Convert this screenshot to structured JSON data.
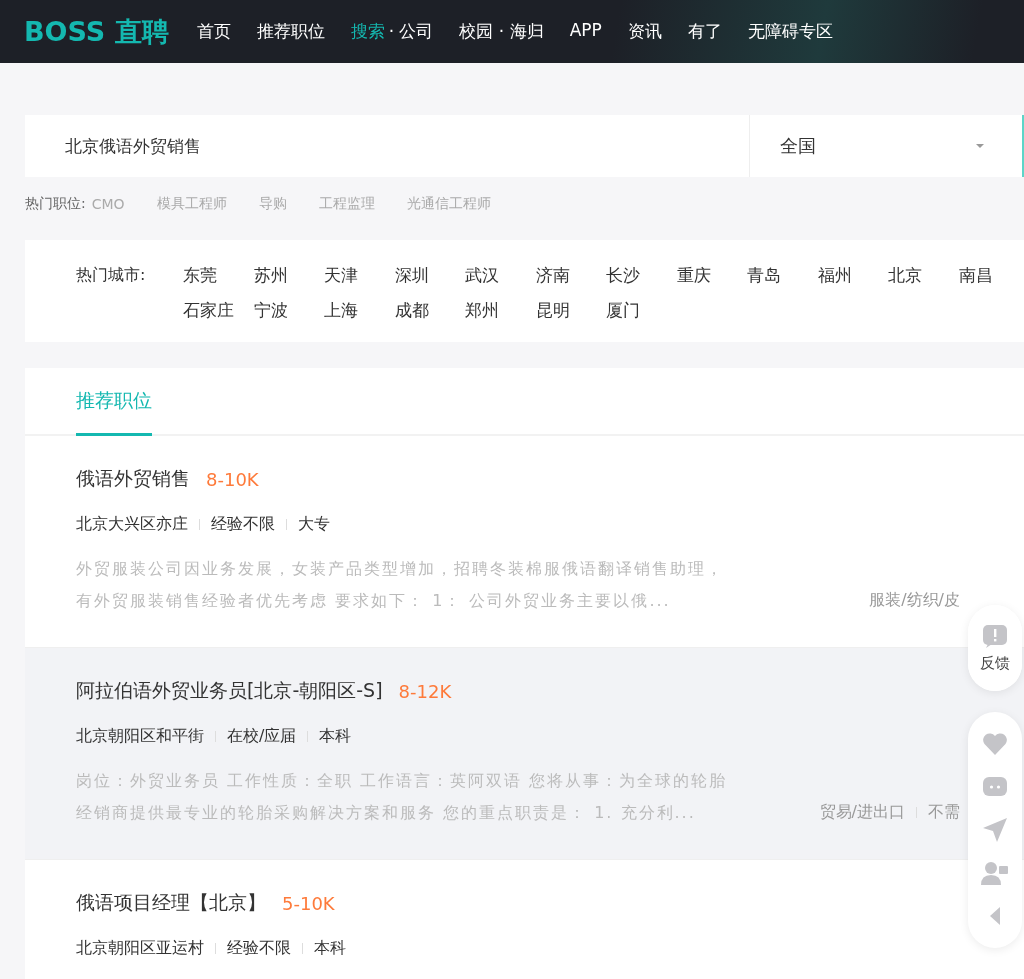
{
  "header": {
    "logo": "BOSS 直聘",
    "nav": [
      {
        "parts": [
          {
            "label": "首页",
            "selected": false
          }
        ]
      },
      {
        "parts": [
          {
            "label": "推荐职位",
            "selected": false
          }
        ]
      },
      {
        "parts": [
          {
            "label": "搜索",
            "selected": true
          },
          {
            "label": "· 公司",
            "selected": false
          }
        ]
      },
      {
        "parts": [
          {
            "label": "校园 · 海归",
            "selected": false
          }
        ]
      },
      {
        "parts": [
          {
            "label": "APP",
            "selected": false
          }
        ]
      },
      {
        "parts": [
          {
            "label": "资讯",
            "selected": false
          }
        ]
      },
      {
        "parts": [
          {
            "label": "有了",
            "selected": false
          }
        ]
      },
      {
        "parts": [
          {
            "label": "无障碍专区",
            "selected": false
          }
        ]
      }
    ]
  },
  "search": {
    "value": "北京俄语外贸销售",
    "city": "全国"
  },
  "hot_jobs": {
    "label": "热门职位:",
    "items": [
      "CMO",
      "模具工程师",
      "导购",
      "工程监理",
      "光通信工程师"
    ]
  },
  "hot_cities": {
    "label": "热门城市:",
    "items": [
      "东莞",
      "苏州",
      "天津",
      "深圳",
      "武汉",
      "济南",
      "长沙",
      "重庆",
      "青岛",
      "福州",
      "北京",
      "南昌",
      "石家庄",
      "宁波",
      "上海",
      "成都",
      "郑州",
      "昆明",
      "厦门"
    ]
  },
  "tabs": [
    {
      "label": "推荐职位",
      "selected": true
    }
  ],
  "jobs": [
    {
      "title": "俄语外贸销售",
      "salary": "8-10K",
      "meta": [
        "北京大兴区亦庄",
        "经验不限",
        "大专"
      ],
      "description": "外贸服装公司因业务发展，女装产品类型增加，招聘冬装棉服俄语翻译销售助理，有外贸服装销售经验者优先考虑 要求如下： 1： 公司外贸业务主要以俄...",
      "tags": [
        "服装/纺织/皮"
      ],
      "hovered": false
    },
    {
      "title": "阿拉伯语外贸业务员[北京-朝阳区-S]",
      "salary": "8-12K",
      "meta": [
        "北京朝阳区和平街",
        "在校/应届",
        "本科"
      ],
      "description": "岗位：外贸业务员 工作性质：全职 工作语言：英阿双语 您将从事：为全球的轮胎经销商提供最专业的轮胎采购解决方案和服务 您的重点职责是： 1. 充分利...",
      "tags": [
        "贸易/进出口",
        "不需"
      ],
      "hovered": true
    },
    {
      "title": "俄语项目经理【北京】",
      "salary": "5-10K",
      "meta": [
        "北京朝阳区亚运村",
        "经验不限",
        "本科"
      ],
      "hovered": false
    }
  ],
  "side_widget": {
    "feedback": "反馈"
  }
}
